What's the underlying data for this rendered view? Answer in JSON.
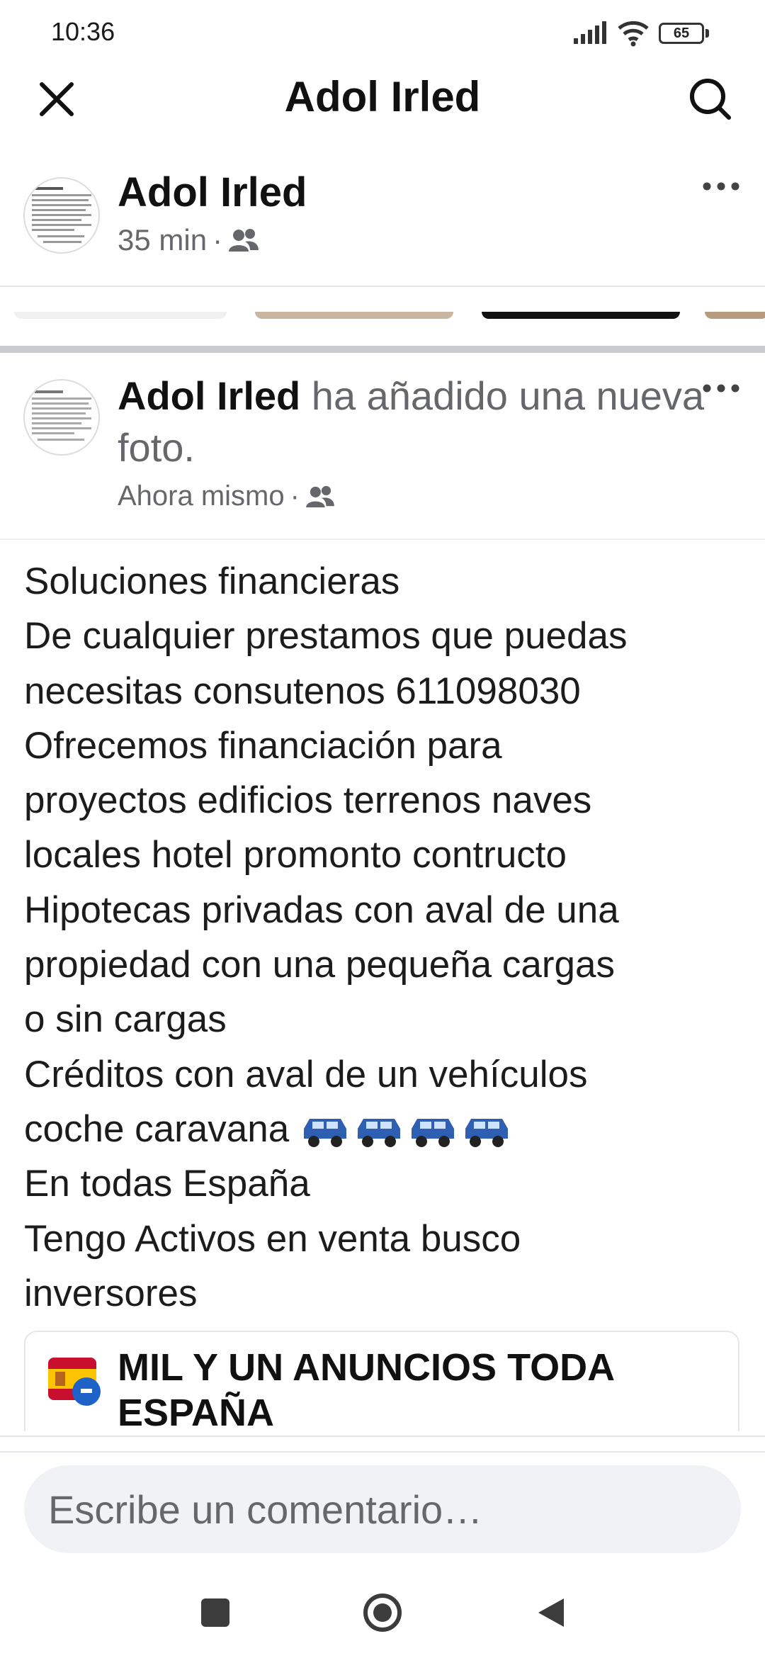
{
  "status_bar": {
    "time": "10:36",
    "battery": "65",
    "icons": [
      "signal-icon",
      "wifi-icon",
      "battery-icon"
    ]
  },
  "top_bar": {
    "title": "Adol Irled",
    "left_icon": "close-icon",
    "right_icon": "search-icon"
  },
  "post_1": {
    "author": "Adol Irled",
    "time": "35 min",
    "separator": "·",
    "audience_icon": "friends-icon",
    "menu_icon": "more-icon"
  },
  "post_2": {
    "author": "Adol Irled",
    "action_text": " ha añadido una nueva foto.",
    "time": "Ahora mismo",
    "separator": "·",
    "audience_icon": "friends-icon",
    "menu_icon": "more-icon",
    "body_lines": [
      "Soluciones financieras",
      "De cualquier prestamos que puedas",
      "necesitas consutenos 611098030",
      "Ofrecemos financiación para",
      "proyectos edificios terrenos naves",
      "locales hotel promonto contructo",
      "Hipotecas privadas con aval de una",
      "propiedad con una pequeña cargas",
      "o sin cargas",
      "Créditos con aval de un vehículos",
      "coche caravana ",
      " En todas España",
      "Tengo Activos en venta busco",
      "inversores"
    ],
    "emoji_count": 4,
    "emoji_icon": "suv-icon",
    "link_card": {
      "title": "MIL Y UN ANUNCIOS TODA ESPAÑA"
    }
  },
  "comment": {
    "placeholder": "Escribe un comentario…"
  },
  "nav": {
    "icons": [
      "recent-apps-icon",
      "home-icon",
      "back-icon"
    ]
  },
  "colors": {
    "text": "#111111",
    "secondary_text": "#65676b",
    "input_bg": "#f0f2f5",
    "divider": "#c8ccd0",
    "suv_blue": "#2e5fb3"
  }
}
